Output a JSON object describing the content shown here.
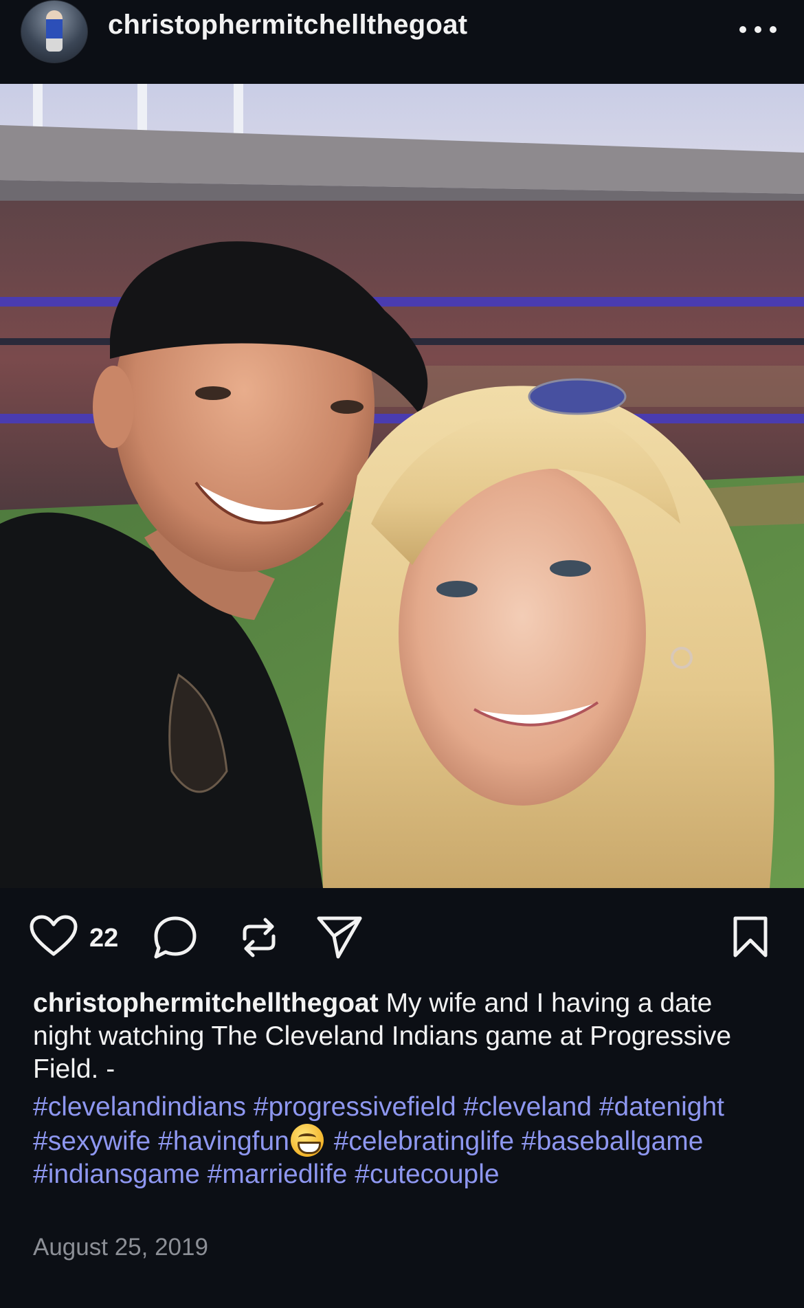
{
  "post": {
    "username": "christophermitchellthegoat",
    "like_count": "22",
    "caption_user": "christophermitchellthegoat",
    "caption_text": " My wife and I having a date night watching The Cleveland Indians game at Progressive Field. -",
    "hashtags_before_emoji": "#clevelandindians #progressivefield #cleveland #datenight #sexywife #havingfun",
    "emoji": "grinning-face-emoji",
    "hashtags_after_emoji": " #celebratinglife #baseballgame #indiansgame #marriedlife #cutecouple",
    "date": "August 25, 2019"
  },
  "icons": {
    "more": "more-options-icon",
    "like": "heart-icon",
    "comment": "comment-bubble-icon",
    "repost": "repost-icon",
    "share": "paper-plane-icon",
    "save": "bookmark-icon"
  },
  "colors": {
    "background": "#0c0f15",
    "text": "#f2f2f2",
    "hashtag": "#8e97f0",
    "muted": "#8c8f96"
  }
}
